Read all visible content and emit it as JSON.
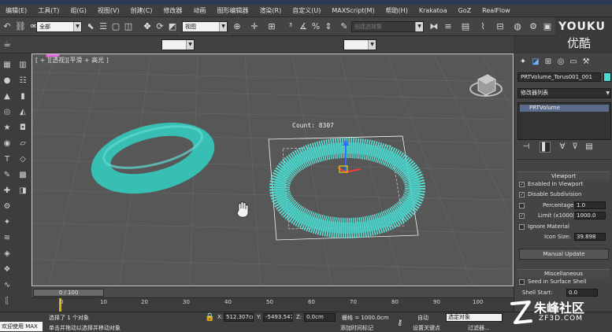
{
  "app": {
    "menu": [
      "编辑(E)",
      "工具(T)",
      "组(G)",
      "视图(V)",
      "创建(C)",
      "修改器",
      "动画",
      "图形编辑器",
      "渲染(R)",
      "自定义(U)",
      "MAXScript(M)",
      "帮助(H)",
      "Krakatoa",
      "GoZ",
      "RealFlow"
    ]
  },
  "toolbar": {
    "selection_filter": "全部",
    "reference_coord": "视图",
    "named_selection_placeholder": "创建选择集",
    "layer_dropdown": "",
    "second_dropdown": ""
  },
  "viewport": {
    "label": "[ + ][透视][平滑 + 高光 ]",
    "count_text": "Count: 8307",
    "logo_z": "Z"
  },
  "command_panel": {
    "object_name": "PRTVolume_Torus001_001",
    "object_color": "#4fd8cf",
    "modifier_list_label": "修改器列表",
    "stack_items": [
      "PRTVolume"
    ],
    "viewport_rollout": {
      "title": "Viewport",
      "enabled_in_viewport": {
        "label": "Enabled In Viewport",
        "checked": true
      },
      "disable_subdivision": {
        "label": "Disable Subdivision",
        "checked": true
      },
      "percentage": {
        "label": "Percentage:",
        "value": "1.0",
        "checked": false
      },
      "limit": {
        "label": "Limit (x1000):",
        "value": "1000.0",
        "checked": true
      },
      "ignore_material": {
        "label": "Ignore Material",
        "checked": false
      },
      "icon_size": {
        "label": "Icon Size:",
        "value": "39.898"
      },
      "manual_update": "Manual Update"
    },
    "misc_rollout": {
      "title": "Miscellaneous",
      "seed_in_surface_shell": {
        "label": "Seed in Surface Shell",
        "checked": false
      },
      "shell_start": {
        "label": "Shell Start:",
        "value": "0.0"
      }
    }
  },
  "timeline": {
    "frame_indicator": "0 / 100",
    "ticks": [
      "0",
      "10",
      "20",
      "30",
      "40",
      "50",
      "60",
      "70",
      "80",
      "90",
      "100"
    ]
  },
  "status": {
    "maxscript_listener": "欢迎使用 MAX",
    "selection_info": "选择了 1 个对象",
    "prompt": "单击并拖动以选择并移动对象",
    "x_label": "X:",
    "x_value": "512.307cm",
    "y_label": "Y:",
    "y_value": "-5493.547c",
    "z_label": "Z:",
    "z_value": "0.0cm",
    "grid": "栅格 = 1000.0cm",
    "add_time_tag": "添加时间标记",
    "auto_key": "自动",
    "key_mode_dropdown": "选定对象",
    "set_key": "设置关键点",
    "key_filters": "过滤器..."
  },
  "watermarks": {
    "youku_top": "YOUKU",
    "youku_bottom": "优酷",
    "zf3d_title": "朱峰社区",
    "zf3d_url": "ZF3D.COM"
  },
  "colors": {
    "viewport_bg": "#575757",
    "torus": "#3ec9bc",
    "particles": "#5ee0d6",
    "logo_pink": "#e56be0"
  }
}
